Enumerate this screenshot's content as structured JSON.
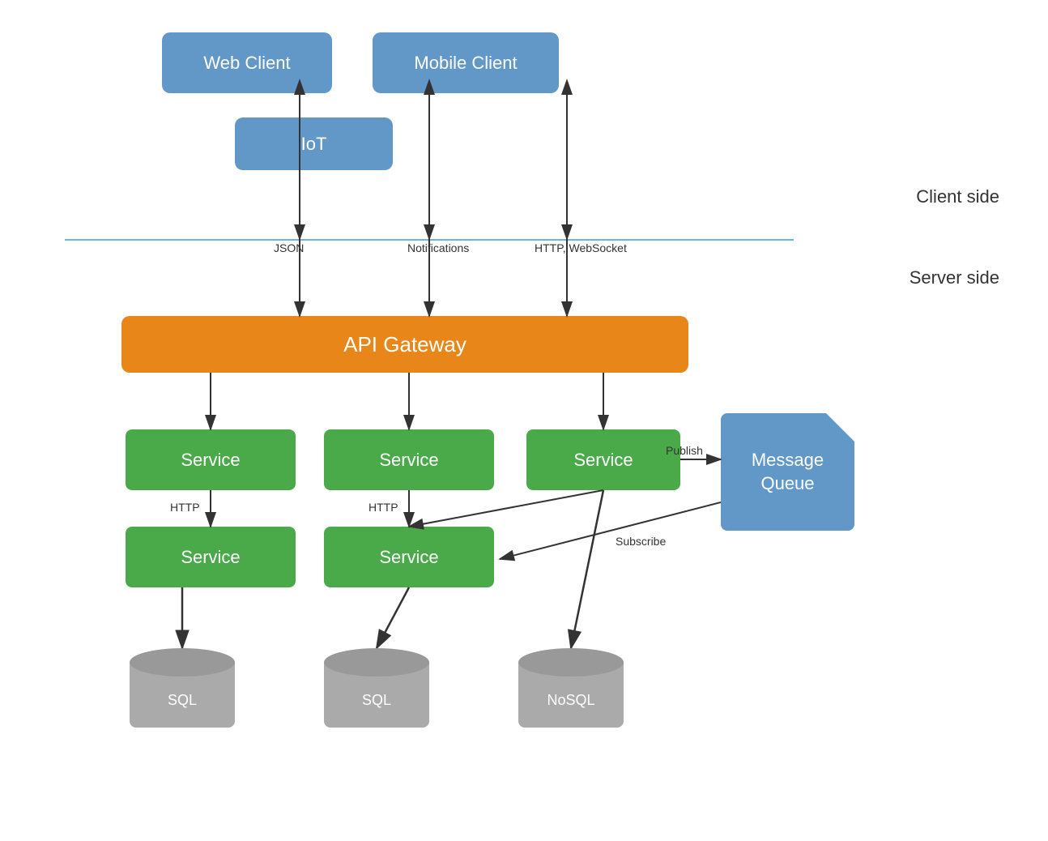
{
  "clients": {
    "web_client": "Web Client",
    "mobile_client": "Mobile Client",
    "iot": "IoT"
  },
  "labels": {
    "client_side": "Client side",
    "server_side": "Server side",
    "api_gateway": "API Gateway",
    "message_queue_line1": "Message",
    "message_queue_line2": "Queue"
  },
  "services": {
    "service_label": "Service"
  },
  "databases": {
    "sql1": "SQL",
    "sql2": "SQL",
    "nosql": "NoSQL"
  },
  "arrow_labels": {
    "json": "JSON",
    "notifications": "Notifications",
    "http_ws": "HTTP, WebSocket",
    "http1": "HTTP",
    "http2": "HTTP",
    "publish": "Publish",
    "subscribe": "Subscribe"
  },
  "colors": {
    "blue": "#6198c8",
    "orange": "#e8861a",
    "green": "#4aaa4a",
    "gray": "#aaaaaa",
    "divider": "#6bb5d6"
  }
}
